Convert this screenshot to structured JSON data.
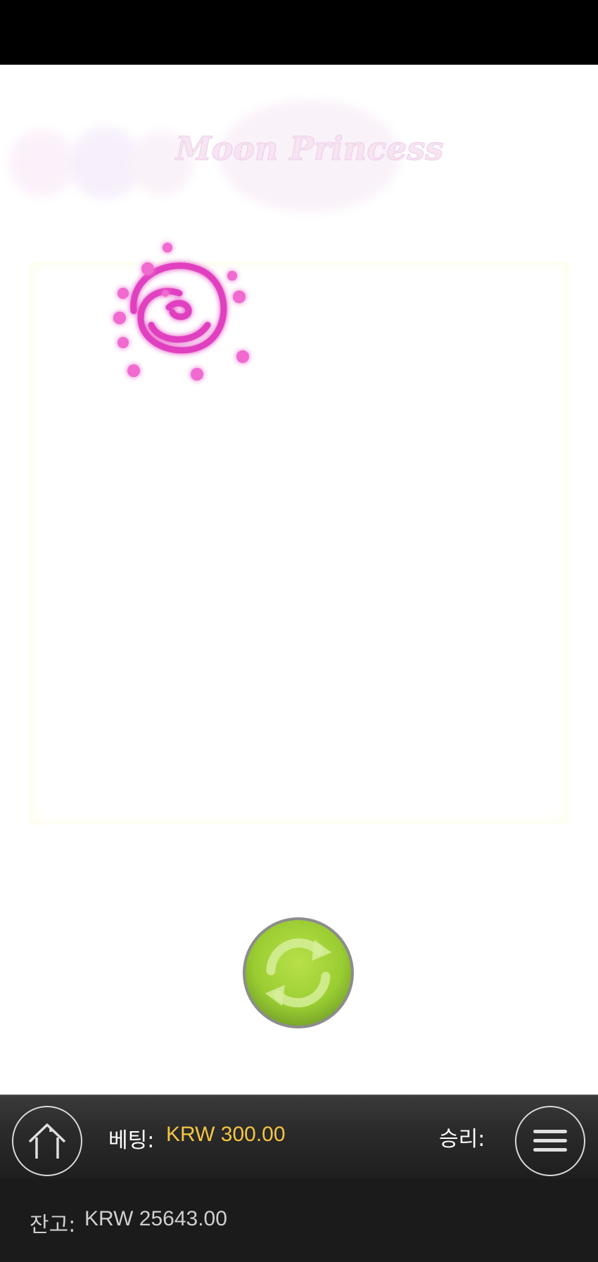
{
  "game": {
    "logo_text": "Moon Princess",
    "accent_color": "#9acd32",
    "symbol_color": "#e040c0"
  },
  "icons": {
    "home": "home-icon",
    "menu": "hamburger-menu-icon",
    "spin": "refresh-arrows-icon"
  },
  "bottom_bar": {
    "bet_label": "베팅:",
    "bet_value": "KRW 300.00",
    "bet_value_color": "#f4c542",
    "win_label": "승리:"
  },
  "balance_bar": {
    "balance_label": "잔고:",
    "balance_value": "KRW 25643.00"
  }
}
